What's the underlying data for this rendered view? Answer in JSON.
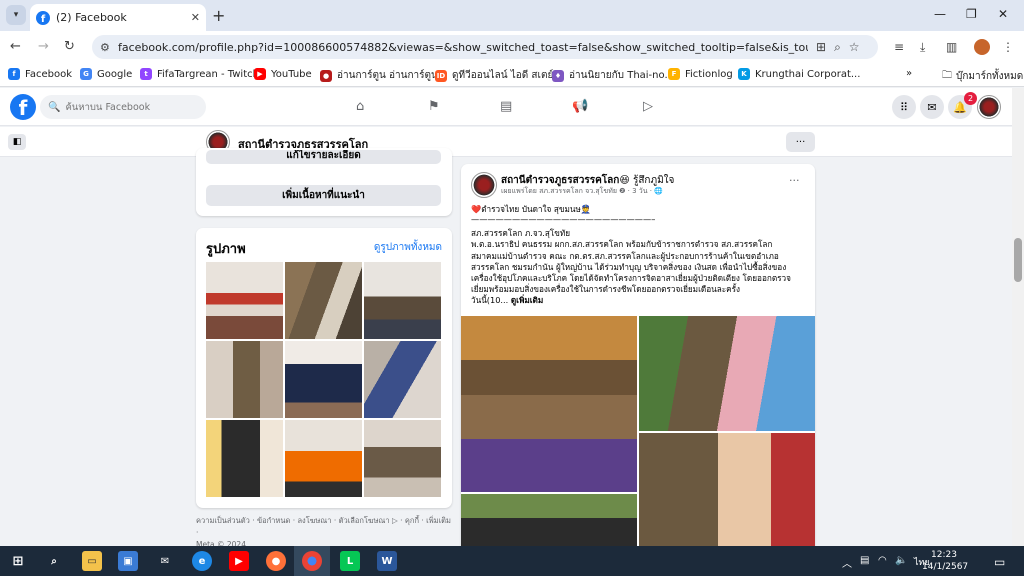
{
  "browser": {
    "tab_title": "(2) Facebook",
    "url": "facebook.com/profile.php?id=100086600574882&viewas=&show_switched_toast=false&show_switched_tooltip=false&is_tour_dismissed=false&is...",
    "bookmarks": [
      {
        "label": "Facebook",
        "color": "#1877f2"
      },
      {
        "label": "Google",
        "color": "#4285f4"
      },
      {
        "label": "FifaTargrean - Twitch",
        "color": "#9146ff"
      },
      {
        "label": "YouTube",
        "color": "#ff0000"
      },
      {
        "label": "อ่านการ์ตูน อ่านการ์ตูน...",
        "color": "#b71c1c"
      },
      {
        "label": "ดูทีวีออนไลน์ ไอดี สเตย์...",
        "color": "#ff5722"
      },
      {
        "label": "อ่านนิยายกับ Thai-no...",
        "color": "#7e57c2"
      },
      {
        "label": "Fictionlog",
        "color": "#ffb300"
      },
      {
        "label": "Krungthai Corporat...",
        "color": "#039be5"
      }
    ],
    "bookmarks_folder": "บุ๊กมาร์กทั้งหมด"
  },
  "fb": {
    "search_placeholder": "ค้นหาบน Facebook",
    "notif_count": "2",
    "nav_icons": [
      "home-icon",
      "flag-icon",
      "chart-icon",
      "megaphone-icon",
      "video-icon"
    ]
  },
  "page": {
    "name": "สถานีตำรวจภูธรสวรรคโลก",
    "more": "···"
  },
  "left": {
    "btn_partial": "แก้ไขรายละเอียด",
    "btn_featured": "เพิ่มเนื้อหาที่แนะนำ",
    "photos_title": "รูปภาพ",
    "photos_all": "ดูรูปภาพทั้งหมด",
    "footer_line1": "ความเป็นส่วนตัว · ข้อกำหนด · ลงโฆษณา · ตัวเลือกโฆษณา ▷ · คุกกี้ · เพิ่มเติม ·",
    "footer_line2": "Meta © 2024"
  },
  "post": {
    "author": "สถานีตำรวจภูธรสวรรคโลก",
    "feeling": "😆 รู้สึกภูมิใจ",
    "meta": "เผยแพร่โดย สภ.สวรรคโลก จว.สุโขทัย ❷ · 3 วัน · 🌐",
    "lines": [
      "❤️ตำรวจไทย บันดาใจ สุขมนษ👮",
      "———————————————————————————.",
      "สภ.สวรรคโลก ภ.จว.สุโขทัย",
      "    พ.ต.อ.นราธิป คนธรรม ผกก.สภ.สวรรคโลก พร้อมกับข้าราชการตำรวจ สภ.สวรรคโลก",
      "สมาคมแม่บ้านตำรวจ คณะ กต.ตร.สภ.สวรรคโลกและผู้ประกอบการร้านค้าในเขตอำเภอ",
      "สวรรคโลก ชมรมกำนัน ผู้ใหญ่บ้าน ได้ร่วมทำบุญ บริจาคสิ่งของ เงินสด เพื่อนำไปซื้อสิ่งของ",
      "เครื่องใช้อุปโภคและบริโภค โดยได้จัดทำโครงการจิตอาสาเยี่ยมผู้ป่วยติดเตียง โดยออกตรวจ",
      "เยี่ยมพร้อมมอบสิ่งของเครื่องใช้ในการดำรงชีพโดยออกตรวจเยี่ยมเดือนละครั้ง",
      "     วันนี้(10..."
    ],
    "see_more": "ดูเพิ่มเติม"
  },
  "taskbar": {
    "lang": "ไทย",
    "time": "12:23",
    "date": "14/1/2567"
  }
}
